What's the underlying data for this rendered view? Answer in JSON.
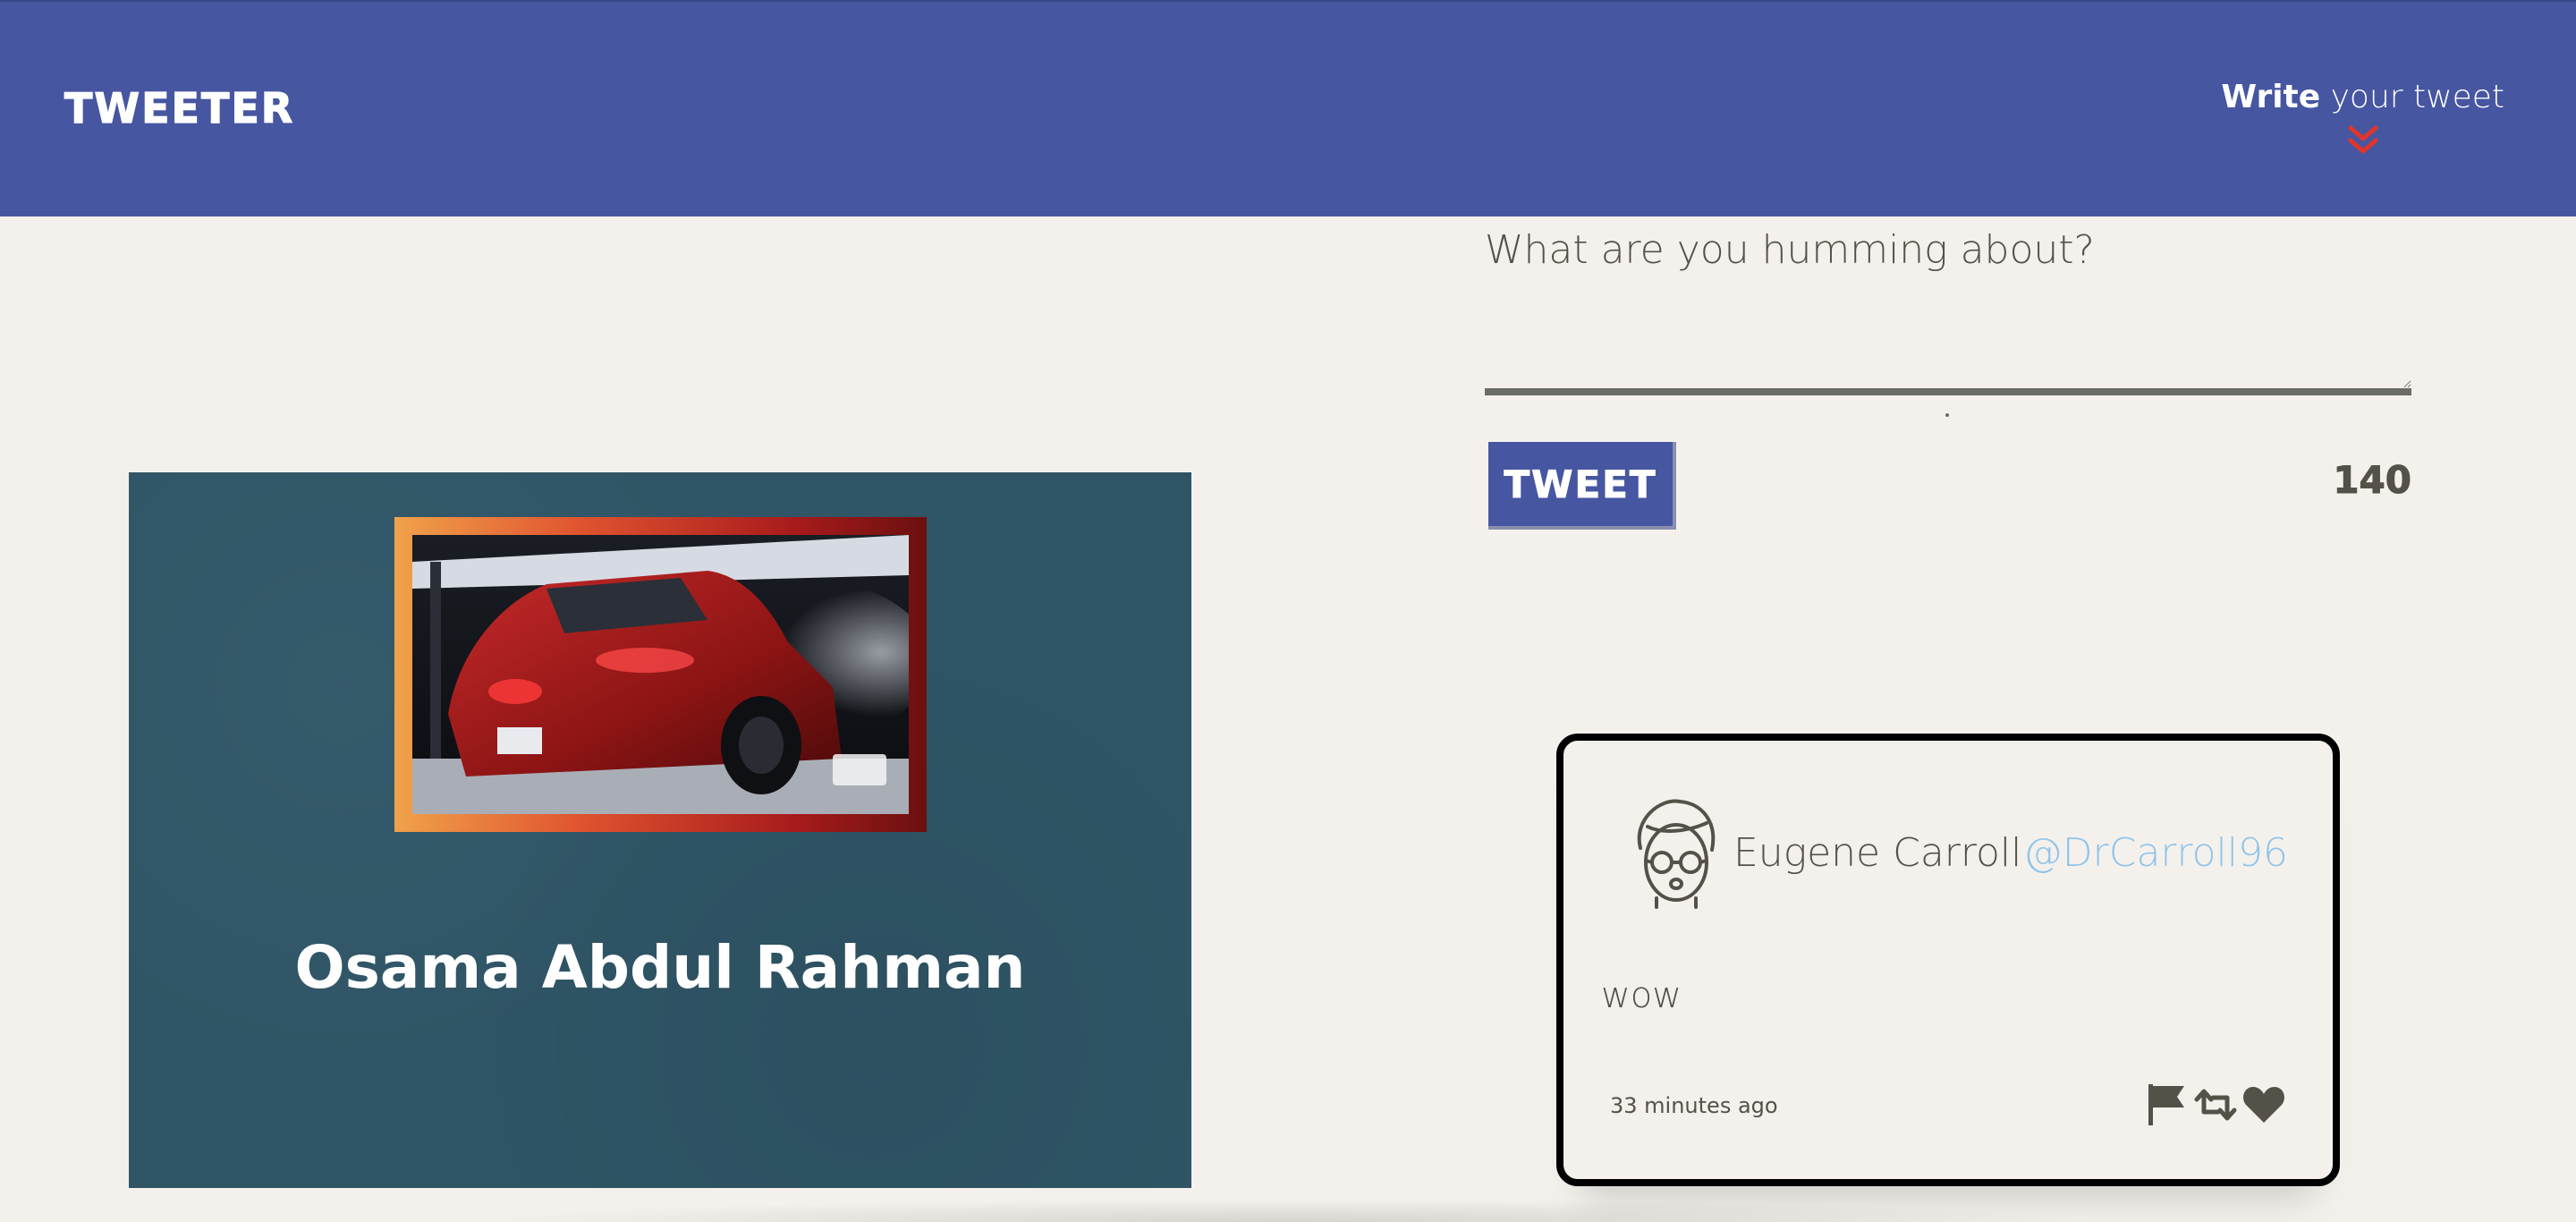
{
  "nav": {
    "brand": "Tweeter",
    "compose_toggle": {
      "bold": "Write",
      "rest": " your tweet",
      "icon": "double-chevron-down-icon",
      "icon_color": "#e0352b"
    }
  },
  "profile": {
    "name": "Osama Abdul Rahman",
    "avatar_alt": "red hatchback car photo"
  },
  "compose": {
    "placeholder": "What are you humming about?",
    "value": "",
    "submit_label": "Tweet",
    "counter": "140"
  },
  "tweets": [
    {
      "author": "Eugene Carroll",
      "handle": "@DrCarroll96",
      "content": "wow",
      "timestamp": "33 minutes ago",
      "actions": [
        "flag-icon",
        "retweet-icon",
        "heart-icon"
      ]
    }
  ],
  "colors": {
    "nav_bg": "#4656a1",
    "page_bg": "#f4f1ed",
    "profile_bg": "#2f5566",
    "handle": "#90c4ea",
    "text": "#545149"
  }
}
